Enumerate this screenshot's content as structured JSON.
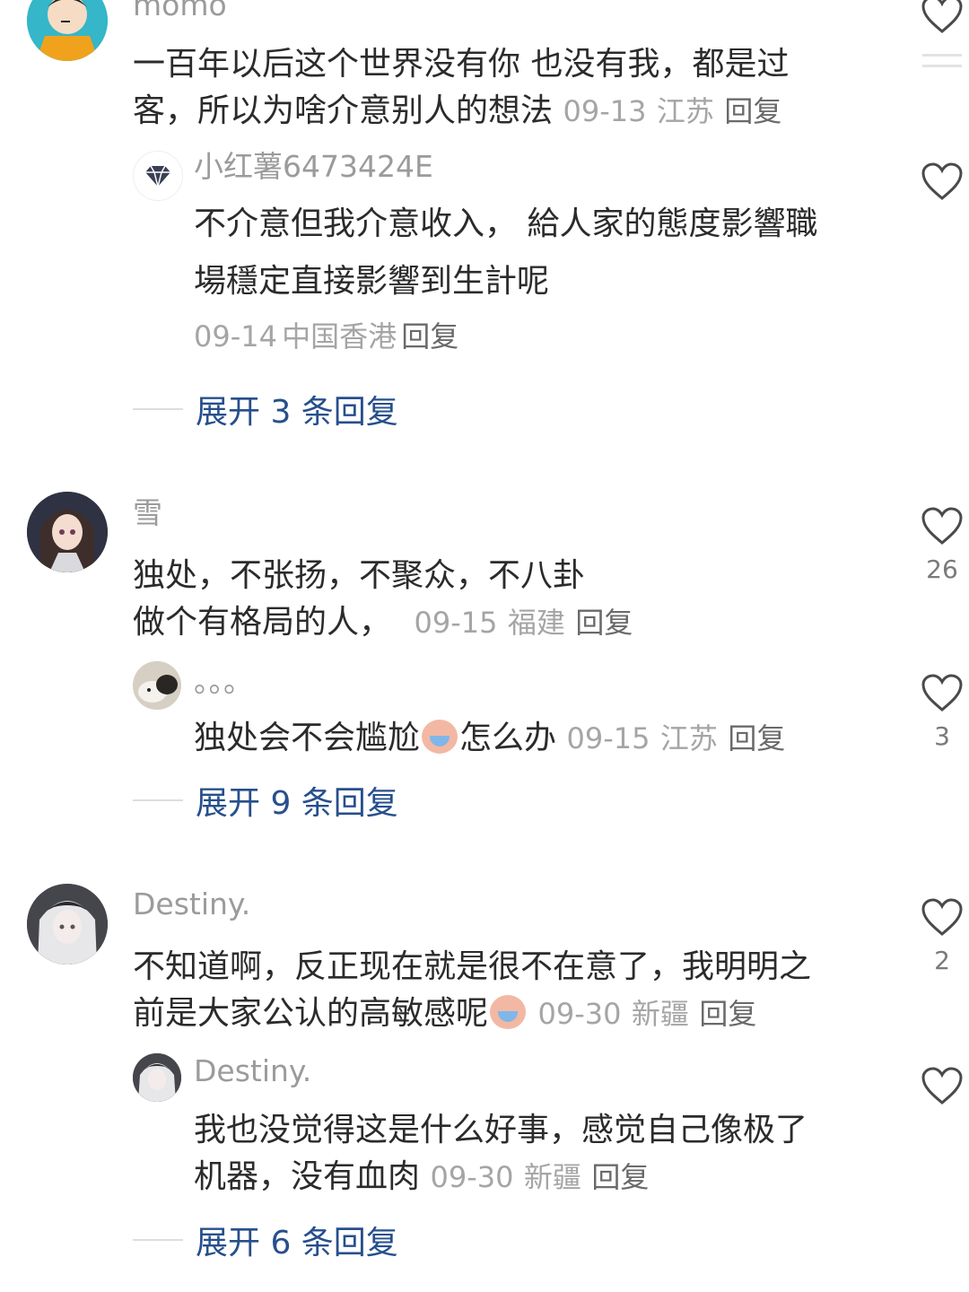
{
  "comments": [
    {
      "username": "momo",
      "line1": "一百年以后这个世界没有你 也没有我，都是过",
      "line2": "客，所以为啥介意别人的想法",
      "time": "09-13",
      "location": "江苏",
      "reply_label": "回复",
      "reply": {
        "username": "小红薯6473424E",
        "line1": "不介意但我介意收入， 給人家的態度影響職",
        "line2": "場穩定直接影響到生計呢",
        "time": "09-14",
        "location": "中国香港",
        "reply_label": "回复"
      },
      "expand_label": "展开 3 条回复"
    },
    {
      "username": "雪",
      "line1": "独处，不张扬，不聚众，不八卦",
      "line2": "做个有格局的人，",
      "time": "09-15",
      "location": "福建",
      "reply_label": "回复",
      "likes": "26",
      "reply": {
        "username": "。。。",
        "line1a": "独处会不会尴尬",
        "line1b": "怎么办",
        "time": "09-15",
        "location": "江苏",
        "reply_label": "回复",
        "likes": "3"
      },
      "expand_label": "展开 9 条回复"
    },
    {
      "username": "Destiny.",
      "line1": "不知道啊，反正现在就是很不在意了，我明明之",
      "line2": "前是大家公认的高敏感呢",
      "time": "09-30",
      "location": "新疆",
      "reply_label": "回复",
      "likes": "2",
      "reply": {
        "username": "Destiny.",
        "line1": "我也没觉得这是什么好事，感觉自己像极了",
        "line2": "机器，没有血肉",
        "time": "09-30",
        "location": "新疆",
        "reply_label": "回复"
      },
      "expand_label": "展开 6 条回复"
    }
  ],
  "icons": {
    "like": "heart-outline-icon",
    "emoji": "crying-face-emoji-icon",
    "badge": "diamond-icon"
  },
  "colors": {
    "expand_link": "#274f8c",
    "meta": "#a5a5a5",
    "username": "#9b9b9b"
  }
}
